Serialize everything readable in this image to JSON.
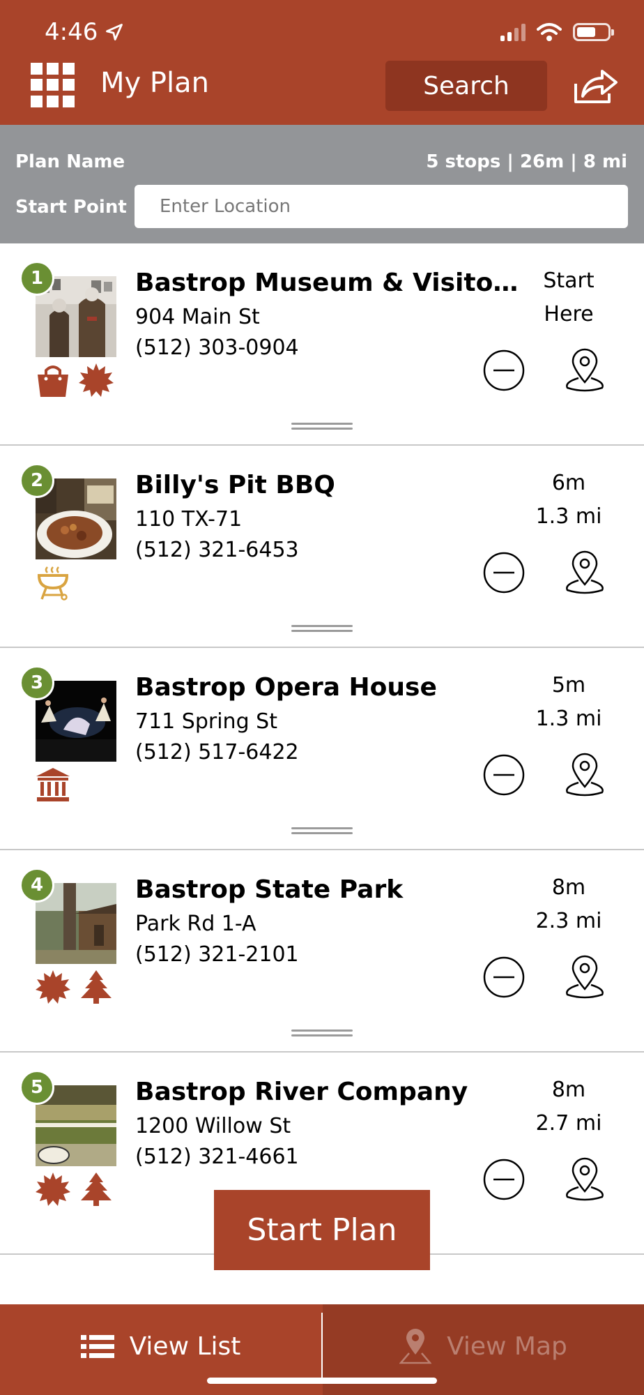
{
  "status": {
    "time": "4:46"
  },
  "header": {
    "title": "My Plan",
    "search_label": "Search"
  },
  "planbar": {
    "plan_name_label": "Plan Name",
    "stats": "5 stops | 26m | 8 mi",
    "start_point_label": "Start Point",
    "location_placeholder": "Enter Location"
  },
  "stops": [
    {
      "number": "1",
      "name": "Bastrop Museum & Visitor Ce...",
      "address": "904 Main St",
      "phone": "(512) 303-0904",
      "time": "Start",
      "distance": "Here",
      "categories": [
        "shopping-bag-icon",
        "starburst-icon"
      ]
    },
    {
      "number": "2",
      "name": "Billy's Pit BBQ",
      "address": "110 TX-71",
      "phone": "(512) 321-6453",
      "time": "6m",
      "distance": "1.3 mi",
      "categories": [
        "grill-icon"
      ]
    },
    {
      "number": "3",
      "name": "Bastrop Opera House",
      "address": "711 Spring St",
      "phone": "(512) 517-6422",
      "time": "5m",
      "distance": "1.3 mi",
      "categories": [
        "museum-icon"
      ]
    },
    {
      "number": "4",
      "name": "Bastrop State Park",
      "address": "Park Rd 1-A",
      "phone": "(512) 321-2101",
      "time": "8m",
      "distance": "2.3 mi",
      "categories": [
        "starburst-icon",
        "pine-tree-icon"
      ]
    },
    {
      "number": "5",
      "name": "Bastrop River Company",
      "address": "1200 Willow St",
      "phone": "(512) 321-4661",
      "time": "8m",
      "distance": "2.7 mi",
      "categories": [
        "starburst-icon",
        "pine-tree-icon"
      ]
    }
  ],
  "start_plan_label": "Start Plan",
  "tabs": {
    "list_label": "View List",
    "map_label": "View Map"
  },
  "colors": {
    "brand": "#a9442a",
    "badge_green": "#6a8f33",
    "plan_bar_gray": "#939598",
    "grill_gold": "#d9a441"
  }
}
